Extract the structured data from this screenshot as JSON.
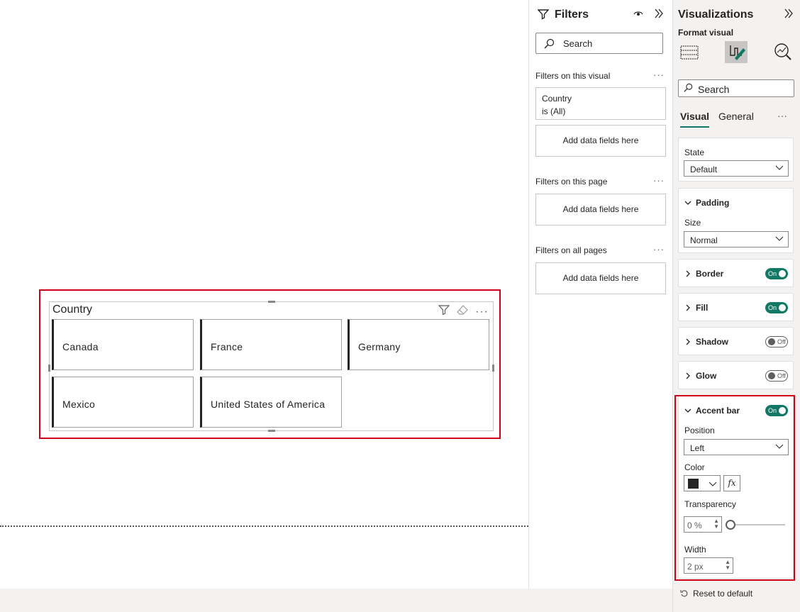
{
  "slicer": {
    "title": "Country",
    "items": [
      "Canada",
      "France",
      "Germany",
      "Mexico",
      "United States of America"
    ]
  },
  "filters": {
    "title": "Filters",
    "search_placeholder": "Search",
    "on_visual_label": "Filters on this visual",
    "country_field": "Country",
    "country_value": "is (All)",
    "add_fields_1": "Add data fields here",
    "on_page_label": "Filters on this page",
    "add_fields_2": "Add data fields here",
    "all_pages_label": "Filters on all pages",
    "add_fields_3": "Add data fields here",
    "dots": "···"
  },
  "viz": {
    "title": "Visualizations",
    "format_visual": "Format visual",
    "search_placeholder": "Search",
    "tab_visual": "Visual",
    "tab_general": "General",
    "more": "···",
    "state_label": "State",
    "state_value": "Default",
    "padding_label": "Padding",
    "size_label": "Size",
    "size_value": "Normal",
    "border_label": "Border",
    "border_toggle": "On",
    "fill_label": "Fill",
    "fill_toggle": "On",
    "shadow_label": "Shadow",
    "shadow_toggle": "Off",
    "glow_label": "Glow",
    "glow_toggle": "Off",
    "accent_label": "Accent bar",
    "accent_toggle": "On",
    "position_label": "Position",
    "position_value": "Left",
    "color_label": "Color",
    "color_value": "#252423",
    "fx": "fx",
    "transparency_label": "Transparency",
    "transparency_value": "0 %",
    "width_label": "Width",
    "width_value": "2 px",
    "reset": "Reset to default"
  },
  "colors": {
    "accent_teal": "#117865",
    "highlight_red": "#d0021b"
  }
}
